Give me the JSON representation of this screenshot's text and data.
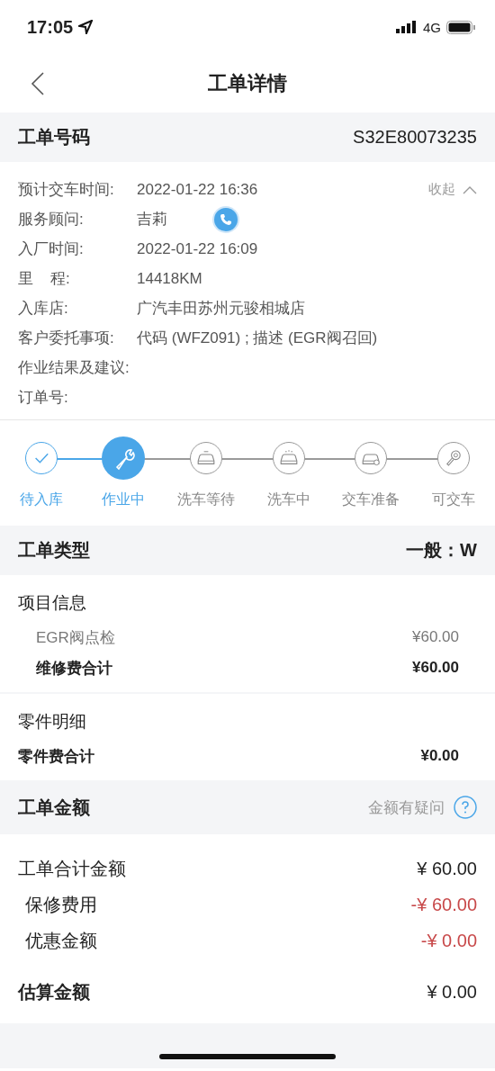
{
  "status_bar": {
    "time": "17:05",
    "network": "4G"
  },
  "nav": {
    "title": "工单详情"
  },
  "order_number": {
    "label": "工单号码",
    "value": "S32E80073235"
  },
  "details": {
    "collapse_label": "收起",
    "expanded": true,
    "rows": [
      {
        "label": "预计交车时间:",
        "value": "2022-01-22 16:36",
        "kind": "text"
      },
      {
        "label": "服务顾问:",
        "value": "吉莉",
        "kind": "phone"
      },
      {
        "label": "入厂时间:",
        "value": "2022-01-22 16:09",
        "kind": "text"
      },
      {
        "label": "里    程:",
        "value": "14418KM",
        "kind": "text"
      },
      {
        "label": "入库店:",
        "value": "广汽丰田苏州元骏相城店",
        "kind": "text"
      },
      {
        "label": "客户委托事项:",
        "value": "代码 (WFZ091) ; 描述 (EGR阀召回)",
        "kind": "text"
      },
      {
        "label": "作业结果及建议:",
        "kind": "text"
      },
      {
        "label": "订单号:",
        "kind": "text"
      }
    ]
  },
  "progress": [
    {
      "label": "待入库",
      "kind": "check",
      "completed": true,
      "selected": false
    },
    {
      "label": "作业中",
      "kind": "wrench",
      "completed": true,
      "selected": true
    },
    {
      "label": "洗车等待",
      "kind": "car",
      "completed": false,
      "selected": false
    },
    {
      "label": "洗车中",
      "kind": "car-wash",
      "completed": false,
      "selected": false
    },
    {
      "label": "交车准备",
      "kind": "car-clock",
      "completed": false,
      "selected": false
    },
    {
      "label": "可交车",
      "kind": "key",
      "completed": false,
      "selected": false
    }
  ],
  "order_type": {
    "label": "工单类型",
    "value": "一般：W"
  },
  "items": {
    "title": "项目信息",
    "rows": [
      {
        "name": "EGR阀点检",
        "price": "¥60.00",
        "kind": "item"
      },
      {
        "name": "维修费合计",
        "price": "¥60.00",
        "kind": "total"
      }
    ]
  },
  "parts": {
    "title": "零件明细",
    "total_label": "零件费合计",
    "total": "¥0.00"
  },
  "amount": {
    "title": "工单金额",
    "question": "金额有疑问",
    "rows": [
      {
        "label": "工单合计金额",
        "value": "¥ 60.00",
        "kind": "normal"
      },
      {
        "label": "保修费用",
        "value": "-¥ 60.00",
        "kind": "deduction"
      },
      {
        "label": "优惠金额",
        "value": "-¥ 0.00",
        "kind": "deduction"
      }
    ],
    "estimate_label": "估算金额",
    "estimate": "¥ 0.00"
  }
}
